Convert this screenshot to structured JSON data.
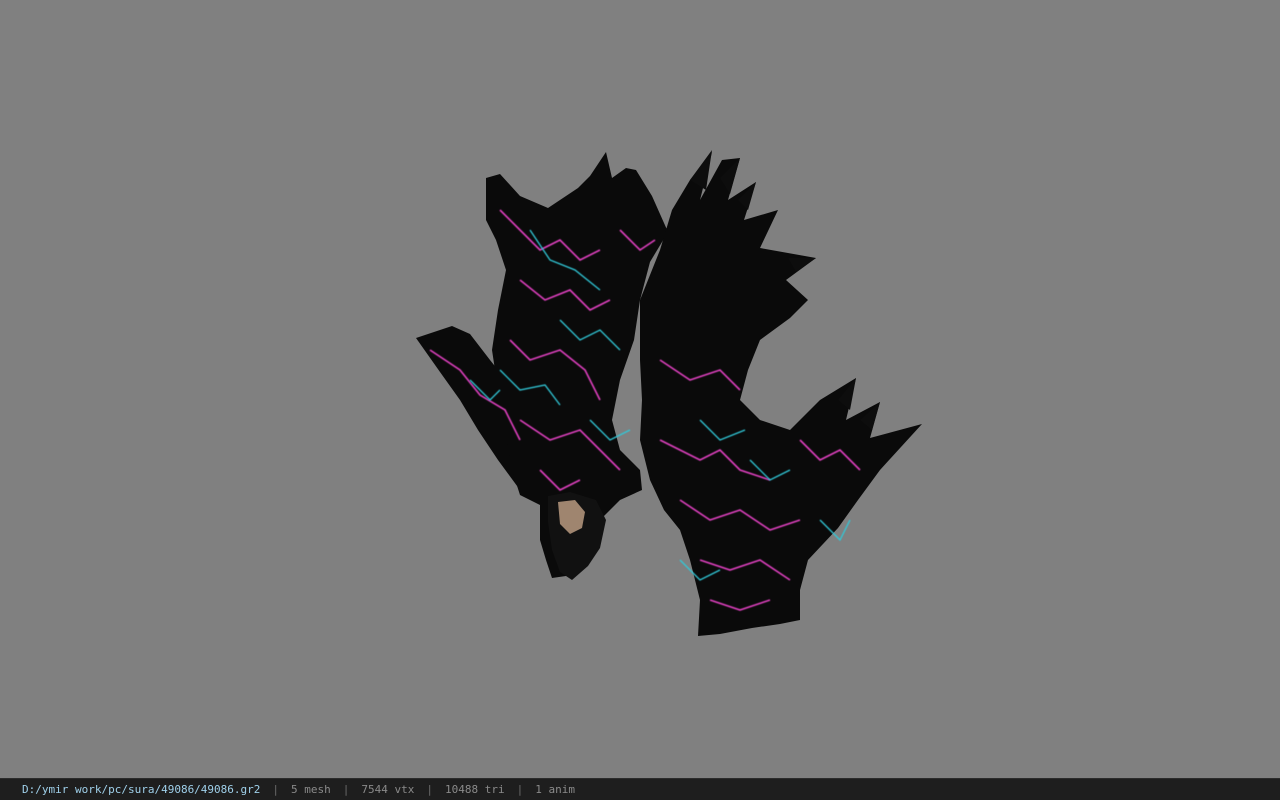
{
  "viewer": {
    "background_color": "#808080",
    "model": {
      "texture_colors": [
        "#0a0a0a",
        "#e040c0",
        "#30c8d8"
      ]
    }
  },
  "status": {
    "file_path": "D:/ymir work/pc/sura/49086/49086.gr2",
    "separator": "|",
    "mesh_count": "5 mesh",
    "vertex_count": "7544 vtx",
    "triangle_count": "10488 tri",
    "animation_count": "1 anim"
  }
}
